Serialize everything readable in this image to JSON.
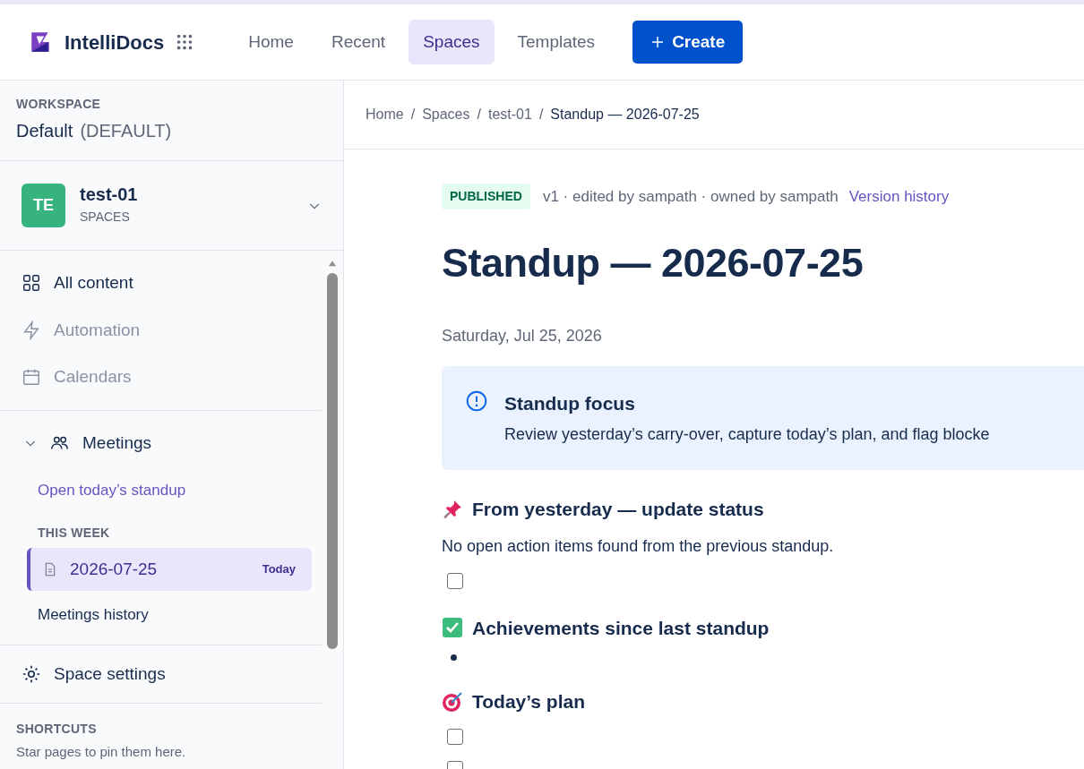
{
  "app": {
    "name": "IntelliDocs"
  },
  "nav": [
    {
      "label": "Home",
      "selected": false
    },
    {
      "label": "Recent",
      "selected": false
    },
    {
      "label": "Spaces",
      "selected": true
    },
    {
      "label": "Templates",
      "selected": false
    }
  ],
  "create_button": {
    "label": "Create"
  },
  "workspace": {
    "heading": "WORKSPACE",
    "name": "Default",
    "tag": "(DEFAULT)"
  },
  "space": {
    "avatar": "TE",
    "name": "test-01",
    "type": "SPACES"
  },
  "sidebar": {
    "items": [
      {
        "label": "All content",
        "disabled": false
      },
      {
        "label": "Automation",
        "disabled": true
      },
      {
        "label": "Calendars",
        "disabled": true
      }
    ]
  },
  "meetings": {
    "label": "Meetings",
    "expanded": true,
    "action": "Open today’s standup",
    "section": "THIS WEEK",
    "pages": [
      {
        "label": "2026-07-25",
        "badge": "Today",
        "selected": true
      }
    ],
    "history": "Meetings history"
  },
  "settings": {
    "label": "Space settings"
  },
  "shortcuts": {
    "heading": "SHORTCUTS",
    "hint": "Star pages to pin them here."
  },
  "breadcrumb": {
    "separator": "/",
    "items": [
      {
        "label": "Home"
      },
      {
        "label": "Spaces"
      },
      {
        "label": "test-01"
      },
      {
        "label": "Standup — 2026-07-25"
      }
    ]
  },
  "page": {
    "status": "PUBLISHED",
    "meta": "v1 · edited by sampath · owned by sampath",
    "history_link": "Version history",
    "title": "Standup — 2026-07-25",
    "date": "Saturday, Jul 25, 2026",
    "callout": {
      "title": "Standup focus",
      "text": "Review yesterday’s carry-over, capture today’s plan, and flag blocke"
    },
    "sections": [
      {
        "title": "From yesterday — update status",
        "text": "No open action items found from the previous standup.",
        "items": [
          {
            "kind": "checkbox",
            "checked": false
          }
        ]
      },
      {
        "title": "Achievements since last standup",
        "items": [
          {
            "kind": "bullet"
          }
        ]
      },
      {
        "title": "Today’s plan",
        "items": [
          {
            "kind": "checkbox",
            "checked": false
          },
          {
            "kind": "checkbox",
            "checked": false
          }
        ]
      }
    ]
  }
}
